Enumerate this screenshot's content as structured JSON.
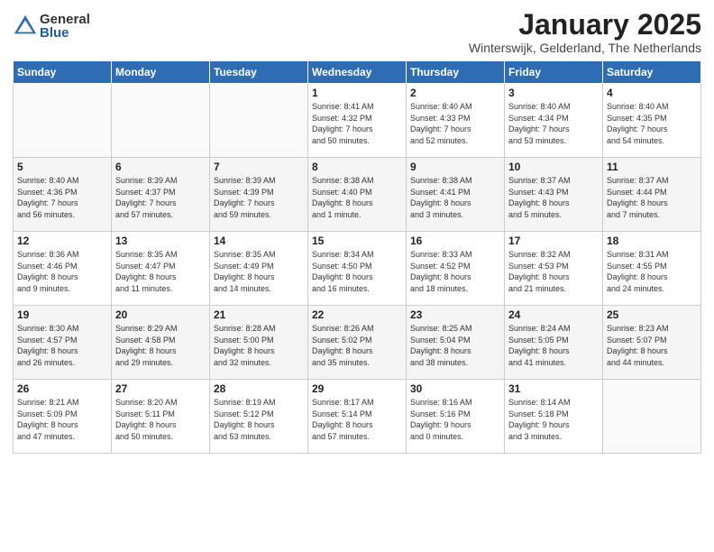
{
  "header": {
    "logo_general": "General",
    "logo_blue": "Blue",
    "month_title": "January 2025",
    "location": "Winterswijk, Gelderland, The Netherlands"
  },
  "days_of_week": [
    "Sunday",
    "Monday",
    "Tuesday",
    "Wednesday",
    "Thursday",
    "Friday",
    "Saturday"
  ],
  "weeks": [
    [
      {
        "num": "",
        "info": ""
      },
      {
        "num": "",
        "info": ""
      },
      {
        "num": "",
        "info": ""
      },
      {
        "num": "1",
        "info": "Sunrise: 8:41 AM\nSunset: 4:32 PM\nDaylight: 7 hours\nand 50 minutes."
      },
      {
        "num": "2",
        "info": "Sunrise: 8:40 AM\nSunset: 4:33 PM\nDaylight: 7 hours\nand 52 minutes."
      },
      {
        "num": "3",
        "info": "Sunrise: 8:40 AM\nSunset: 4:34 PM\nDaylight: 7 hours\nand 53 minutes."
      },
      {
        "num": "4",
        "info": "Sunrise: 8:40 AM\nSunset: 4:35 PM\nDaylight: 7 hours\nand 54 minutes."
      }
    ],
    [
      {
        "num": "5",
        "info": "Sunrise: 8:40 AM\nSunset: 4:36 PM\nDaylight: 7 hours\nand 56 minutes."
      },
      {
        "num": "6",
        "info": "Sunrise: 8:39 AM\nSunset: 4:37 PM\nDaylight: 7 hours\nand 57 minutes."
      },
      {
        "num": "7",
        "info": "Sunrise: 8:39 AM\nSunset: 4:39 PM\nDaylight: 7 hours\nand 59 minutes."
      },
      {
        "num": "8",
        "info": "Sunrise: 8:38 AM\nSunset: 4:40 PM\nDaylight: 8 hours\nand 1 minute."
      },
      {
        "num": "9",
        "info": "Sunrise: 8:38 AM\nSunset: 4:41 PM\nDaylight: 8 hours\nand 3 minutes."
      },
      {
        "num": "10",
        "info": "Sunrise: 8:37 AM\nSunset: 4:43 PM\nDaylight: 8 hours\nand 5 minutes."
      },
      {
        "num": "11",
        "info": "Sunrise: 8:37 AM\nSunset: 4:44 PM\nDaylight: 8 hours\nand 7 minutes."
      }
    ],
    [
      {
        "num": "12",
        "info": "Sunrise: 8:36 AM\nSunset: 4:46 PM\nDaylight: 8 hours\nand 9 minutes."
      },
      {
        "num": "13",
        "info": "Sunrise: 8:35 AM\nSunset: 4:47 PM\nDaylight: 8 hours\nand 11 minutes."
      },
      {
        "num": "14",
        "info": "Sunrise: 8:35 AM\nSunset: 4:49 PM\nDaylight: 8 hours\nand 14 minutes."
      },
      {
        "num": "15",
        "info": "Sunrise: 8:34 AM\nSunset: 4:50 PM\nDaylight: 8 hours\nand 16 minutes."
      },
      {
        "num": "16",
        "info": "Sunrise: 8:33 AM\nSunset: 4:52 PM\nDaylight: 8 hours\nand 18 minutes."
      },
      {
        "num": "17",
        "info": "Sunrise: 8:32 AM\nSunset: 4:53 PM\nDaylight: 8 hours\nand 21 minutes."
      },
      {
        "num": "18",
        "info": "Sunrise: 8:31 AM\nSunset: 4:55 PM\nDaylight: 8 hours\nand 24 minutes."
      }
    ],
    [
      {
        "num": "19",
        "info": "Sunrise: 8:30 AM\nSunset: 4:57 PM\nDaylight: 8 hours\nand 26 minutes."
      },
      {
        "num": "20",
        "info": "Sunrise: 8:29 AM\nSunset: 4:58 PM\nDaylight: 8 hours\nand 29 minutes."
      },
      {
        "num": "21",
        "info": "Sunrise: 8:28 AM\nSunset: 5:00 PM\nDaylight: 8 hours\nand 32 minutes."
      },
      {
        "num": "22",
        "info": "Sunrise: 8:26 AM\nSunset: 5:02 PM\nDaylight: 8 hours\nand 35 minutes."
      },
      {
        "num": "23",
        "info": "Sunrise: 8:25 AM\nSunset: 5:04 PM\nDaylight: 8 hours\nand 38 minutes."
      },
      {
        "num": "24",
        "info": "Sunrise: 8:24 AM\nSunset: 5:05 PM\nDaylight: 8 hours\nand 41 minutes."
      },
      {
        "num": "25",
        "info": "Sunrise: 8:23 AM\nSunset: 5:07 PM\nDaylight: 8 hours\nand 44 minutes."
      }
    ],
    [
      {
        "num": "26",
        "info": "Sunrise: 8:21 AM\nSunset: 5:09 PM\nDaylight: 8 hours\nand 47 minutes."
      },
      {
        "num": "27",
        "info": "Sunrise: 8:20 AM\nSunset: 5:11 PM\nDaylight: 8 hours\nand 50 minutes."
      },
      {
        "num": "28",
        "info": "Sunrise: 8:19 AM\nSunset: 5:12 PM\nDaylight: 8 hours\nand 53 minutes."
      },
      {
        "num": "29",
        "info": "Sunrise: 8:17 AM\nSunset: 5:14 PM\nDaylight: 8 hours\nand 57 minutes."
      },
      {
        "num": "30",
        "info": "Sunrise: 8:16 AM\nSunset: 5:16 PM\nDaylight: 9 hours\nand 0 minutes."
      },
      {
        "num": "31",
        "info": "Sunrise: 8:14 AM\nSunset: 5:18 PM\nDaylight: 9 hours\nand 3 minutes."
      },
      {
        "num": "",
        "info": ""
      }
    ]
  ]
}
